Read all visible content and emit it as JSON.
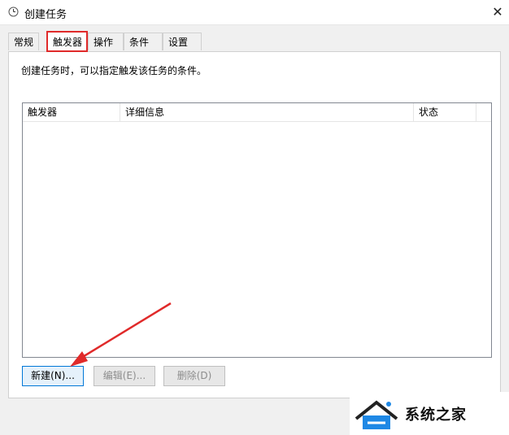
{
  "window": {
    "title": "创建任务",
    "close_glyph": "✕"
  },
  "tabs": [
    {
      "label": "常规",
      "selected": false
    },
    {
      "label": "触发器",
      "selected": true
    },
    {
      "label": "操作",
      "selected": false
    },
    {
      "label": "条件",
      "selected": false
    },
    {
      "label": "设置",
      "selected": false
    }
  ],
  "tab_page": {
    "description": "创建任务时，可以指定触发该任务的条件。"
  },
  "list": {
    "columns": [
      "触发器",
      "详细信息",
      "状态"
    ],
    "rows": []
  },
  "buttons": {
    "new_label": "新建(N)...",
    "edit_label": "编辑(E)...",
    "delete_label": "删除(D)"
  },
  "watermark": {
    "text": "系统之家"
  },
  "colors": {
    "highlight": "#e02a2a",
    "arrow": "#e02a2a",
    "watermark_blue": "#1e88e5"
  }
}
